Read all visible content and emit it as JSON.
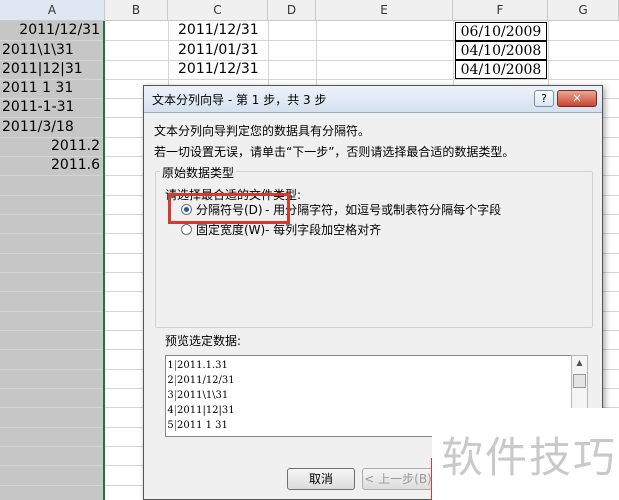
{
  "columns": [
    "A",
    "B",
    "C",
    "D",
    "E",
    "F",
    "G"
  ],
  "column_a_values": [
    "2011/12/31",
    "2011\\1\\31",
    "2011|12|31",
    "2011 1 31",
    "2011-1-31",
    "2011/3/18",
    "2011.2",
    "2011.6"
  ],
  "column_c_values": [
    "2011/12/31",
    "2011/01/31",
    "2011/12/31"
  ],
  "column_f_values": [
    "06/10/2009",
    "04/10/2008",
    "04/10/2008"
  ],
  "dialog": {
    "title": "文本分列向导 - 第 1 步，共 3 步",
    "help_label": "?",
    "close_label": "✕",
    "intro_line1": "文本分列向导判定您的数据具有分隔符。",
    "intro_line2": "若一切设置无误，请单击“下一步”，否则请选择最合适的数据类型。",
    "group_label": "原始数据类型",
    "file_type_prompt": "请选择最合适的文件类型:",
    "option_delimited": "分隔符号(D)",
    "option_delimited_desc": "- 用分隔字符，如逗号或制表符分隔每个字段",
    "option_fixed": "固定宽度(W)",
    "option_fixed_desc": "- 每列字段加空格对齐",
    "selected_option": "delimited",
    "preview_label": "预览选定数据:",
    "preview_lines": [
      {
        "num": "1",
        "text": "2011.1.31"
      },
      {
        "num": "2",
        "text": "2011/12/31"
      },
      {
        "num": "3",
        "text": "2011\\1\\31"
      },
      {
        "num": "4",
        "text": "2011|12|31"
      },
      {
        "num": "5",
        "text": "2011 1 31"
      }
    ],
    "cancel_label": "取消",
    "back_label": "< 上一步(B)"
  },
  "watermark": "软件技巧",
  "colors": {
    "highlight_red": "#d63a2c",
    "column_selection": "#c6c6c6",
    "dialog_bg": "#f0f0f0"
  }
}
